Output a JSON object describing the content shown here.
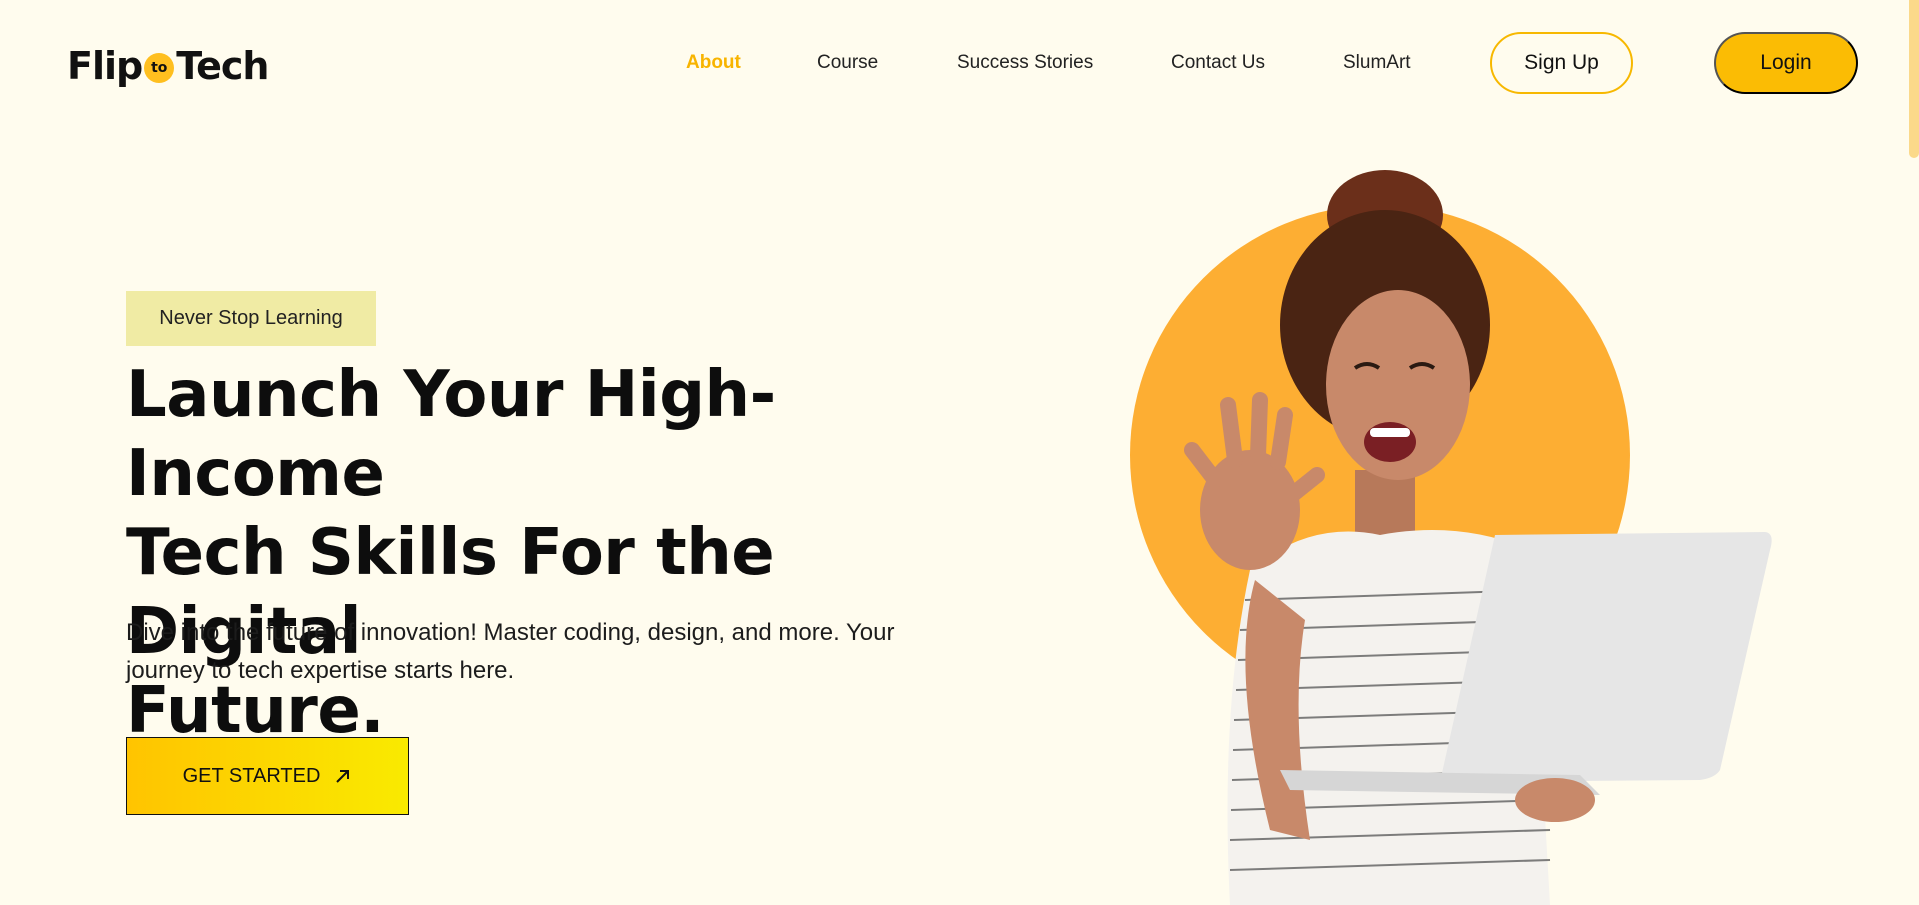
{
  "brand": {
    "logo_left": "Flip",
    "logo_mid": "to",
    "logo_right": "Tech"
  },
  "nav": {
    "items": [
      {
        "label": "About",
        "active": true
      },
      {
        "label": "Course",
        "active": false
      },
      {
        "label": "Success Stories",
        "active": false
      },
      {
        "label": "Contact Us",
        "active": false
      },
      {
        "label": "SlumArt",
        "active": false
      }
    ],
    "signup_label": "Sign Up",
    "login_label": "Login"
  },
  "hero": {
    "tagline": "Never Stop Learning",
    "headline_lines": [
      "Launch Your High-Income",
      "Tech Skills For the Digital",
      "Future."
    ],
    "subtext_lines": [
      "Dive into the future of innovation! Master coding, design, and more. Your",
      "journey to tech expertise starts here."
    ],
    "cta_label": "GET STARTED",
    "cta_icon": "arrow-up-right-icon",
    "image_subject": "woman-waving-with-laptop"
  },
  "colors": {
    "background": "#fffcee",
    "accent": "#fbbc04",
    "active_nav": "#f8b400",
    "tagline_bg": "#f0eba4",
    "circle": "#fdae33"
  }
}
